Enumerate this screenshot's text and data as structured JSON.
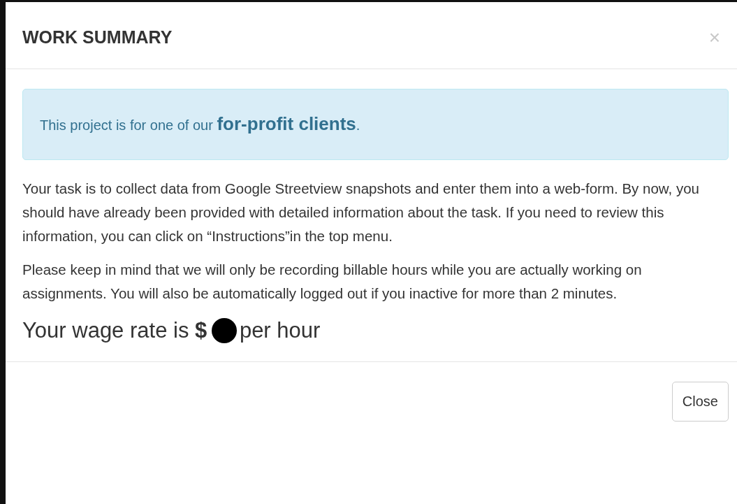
{
  "modal": {
    "title": "WORK SUMMARY",
    "close_icon": "×",
    "alert": "This project is for one of our **for-profit clients**.",
    "paragraphs": [
      "Your task is to collect data from Google Streetview snapshots and enter them into a web-form. By now, you should have already been provided with detailed information about the task. If you need to review this information, you can click on “Instructions”in the top menu.",
      "Please keep in mind that we will only be recording billable hours while you are actually working on assignments. You will also be automatically logged out if you inactive for more than 2 minutes."
    ],
    "wage": {
      "before": "Your wage rate is **$**",
      "redacted": true,
      "after": "per hour"
    },
    "buttons": [
      "Close"
    ]
  }
}
